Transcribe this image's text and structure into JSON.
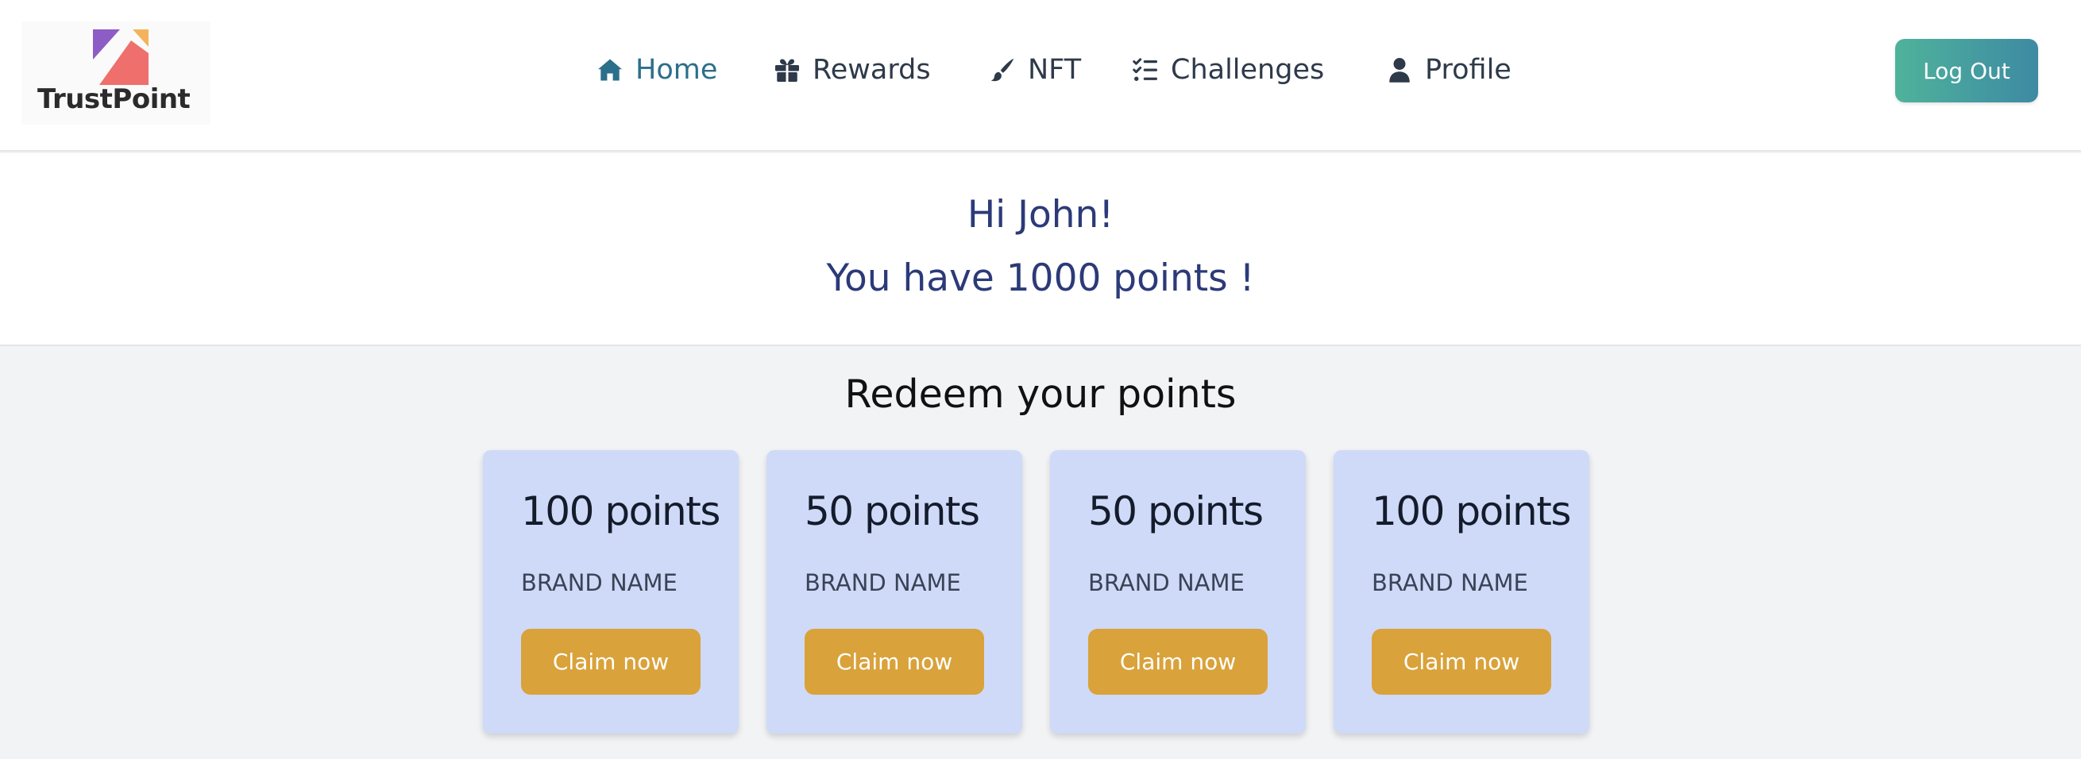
{
  "brand": {
    "logo_text": "TrustPoint"
  },
  "colors": {
    "nav_active": "#2c6f8a",
    "greeting": "#2c3a78",
    "card_bg": "#cfdaf8",
    "claim_button": "#d9a23a",
    "logout_gradient_start": "#4fb39b",
    "logout_gradient_end": "#3d8aa3"
  },
  "nav": {
    "items": [
      {
        "label": "Home",
        "icon": "home-icon",
        "active": true
      },
      {
        "label": "Rewards",
        "icon": "gift-icon",
        "active": false
      },
      {
        "label": "NFT",
        "icon": "brush-icon",
        "active": false
      },
      {
        "label": "Challenges",
        "icon": "list-check-icon",
        "active": false
      },
      {
        "label": "Profile",
        "icon": "user-icon",
        "active": false
      }
    ],
    "logout_label": "Log Out"
  },
  "greeting": {
    "line1": "Hi John!",
    "line2": "You have 1000 points !"
  },
  "redeem": {
    "title": "Redeem your points",
    "cards": [
      {
        "points": "100 points",
        "brand": "BRAND NAME",
        "button": "Claim now"
      },
      {
        "points": "50 points",
        "brand": "BRAND NAME",
        "button": "Claim now"
      },
      {
        "points": "50 points",
        "brand": "BRAND NAME",
        "button": "Claim now"
      },
      {
        "points": "100 points",
        "brand": "BRAND NAME",
        "button": "Claim now"
      }
    ]
  }
}
